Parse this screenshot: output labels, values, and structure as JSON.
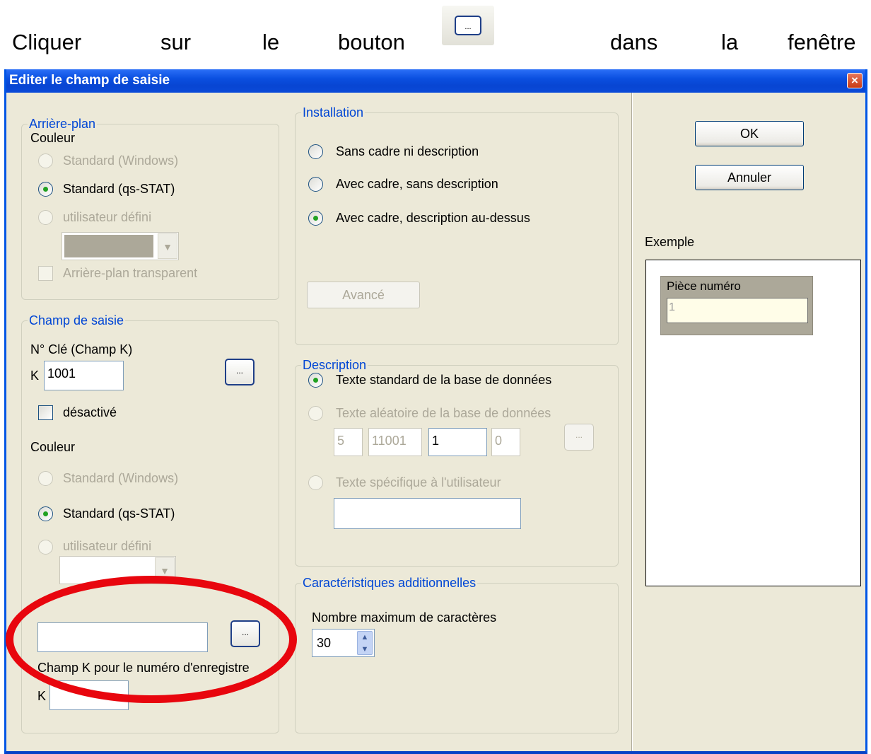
{
  "instruction": {
    "w1": "Cliquer",
    "w2": "sur",
    "w3": "le",
    "w4": "bouton",
    "w5": "dans",
    "w6": "la",
    "w7": "fenêtre",
    "button_label": "..."
  },
  "dialog": {
    "title": "Editer le champ de saisie",
    "close_label": "×",
    "ok_label": "OK",
    "cancel_label": "Annuler",
    "example_label": "Exemple",
    "example_field_label": "Pièce numéro",
    "example_field_value": "1"
  },
  "arriere_plan": {
    "title": "Arrière-plan",
    "couleur": "Couleur",
    "opt_windows": "Standard (Windows)",
    "opt_qs": "Standard (qs-STAT)",
    "opt_user": "utilisateur défini",
    "transparent": "Arrière-plan transparent",
    "selected": "Standard (qs-STAT)"
  },
  "champ_saisie": {
    "title": "Champ de saisie",
    "key_label": "N° Clé (Champ K)",
    "k_prefix": "K",
    "key_value": "1001",
    "dots": "...",
    "disabled_label": "désactivé",
    "couleur": "Couleur",
    "opt_windows": "Standard (Windows)",
    "opt_qs": "Standard (qs-STAT)",
    "opt_user": "utilisateur défini",
    "selected": "Standard (qs-STAT)",
    "record_field_value": "",
    "record_label": "Champ K pour le numéro d'enregistre",
    "record_k_prefix": "K",
    "record_k_value": ""
  },
  "installation": {
    "title": "Installation",
    "opt1": "Sans cadre ni description",
    "opt2": "Avec cadre, sans description",
    "opt3": "Avec cadre, description au-dessus",
    "selected": "Avec cadre, description au-dessus",
    "advanced_label": "Avancé"
  },
  "description": {
    "title": "Description",
    "opt1": "Texte standard de la base de données",
    "opt2": "Texte aléatoire de la base de données",
    "opt3": "Texte spécifique à l'utilisateur",
    "selected": "Texte standard de la base de données",
    "fields": [
      "5",
      "11001",
      "1",
      "0"
    ],
    "dots": "...",
    "user_text": ""
  },
  "caracteristiques": {
    "title": "Caractéristiques additionnelles",
    "max_chars_label": "Nombre maximum de caractères",
    "max_chars_value": "30"
  },
  "icons": {
    "close": "close-icon",
    "combo_arrow": "chevron-down-icon",
    "spin": "spin-arrows-icon"
  },
  "colors": {
    "accent": "#0046d5",
    "titlebar": "#0a4fe0",
    "highlight": "#e8060e",
    "selected_dot": "#21a121"
  }
}
